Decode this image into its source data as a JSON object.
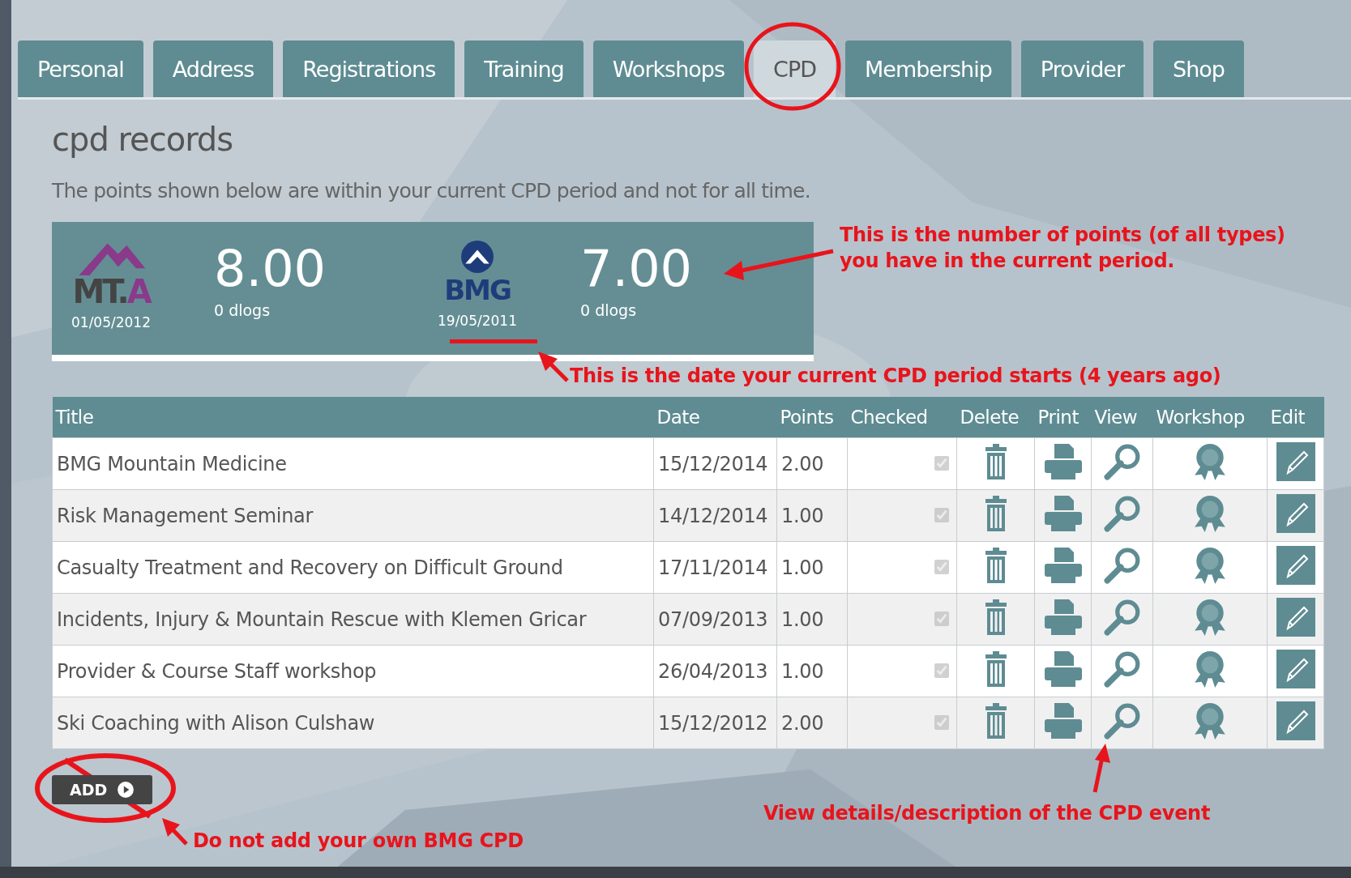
{
  "tabs": [
    {
      "label": "Personal",
      "selected": false
    },
    {
      "label": "Address",
      "selected": false
    },
    {
      "label": "Registrations",
      "selected": false
    },
    {
      "label": "Training",
      "selected": false
    },
    {
      "label": "Workshops",
      "selected": false
    },
    {
      "label": "CPD",
      "selected": true
    },
    {
      "label": "Membership",
      "selected": false
    },
    {
      "label": "Provider",
      "selected": false
    },
    {
      "label": "Shop",
      "selected": false
    }
  ],
  "heading": "cpd records",
  "intro": "The points shown below are within your current CPD period and not for all time.",
  "stats": [
    {
      "kind": "mta",
      "logo_text": "MT.",
      "logo_accent": "A",
      "date": "01/05/2012",
      "points": "8.00",
      "dlogs": "0 dlogs"
    },
    {
      "kind": "bmg",
      "logo_text": "BMG",
      "date": "19/05/2011",
      "points": "7.00",
      "dlogs": "0 dlogs"
    }
  ],
  "table": {
    "columns": [
      "Title",
      "Date",
      "Points",
      "Checked",
      "Delete",
      "Print",
      "View",
      "Workshop",
      "Edit"
    ],
    "rows": [
      {
        "title": "BMG Mountain Medicine",
        "date": "15/12/2014",
        "points": "2.00",
        "checked": true
      },
      {
        "title": "Risk Management Seminar",
        "date": "14/12/2014",
        "points": "1.00",
        "checked": true
      },
      {
        "title": "Casualty Treatment and Recovery on Difficult Ground",
        "date": "17/11/2014",
        "points": "1.00",
        "checked": true
      },
      {
        "title": "Incidents, Injury & Mountain Rescue with Klemen Gricar",
        "date": "07/09/2013",
        "points": "1.00",
        "checked": true
      },
      {
        "title": "Provider & Course Staff workshop",
        "date": "26/04/2013",
        "points": "1.00",
        "checked": true
      },
      {
        "title": "Ski Coaching with Alison Culshaw",
        "date": "15/12/2012",
        "points": "2.00",
        "checked": true
      }
    ]
  },
  "add_button": {
    "label": "ADD"
  },
  "annotations": [
    {
      "kind": "points",
      "lines": [
        "This is the number of points (of all types)",
        "you have in the current period."
      ]
    },
    {
      "kind": "date",
      "lines": [
        "This is the date your current CPD period starts (4 years ago)"
      ]
    },
    {
      "kind": "view",
      "lines": [
        "View details/description of the CPD event"
      ]
    },
    {
      "kind": "add",
      "lines": [
        "Do not add your own BMG CPD"
      ]
    }
  ]
}
